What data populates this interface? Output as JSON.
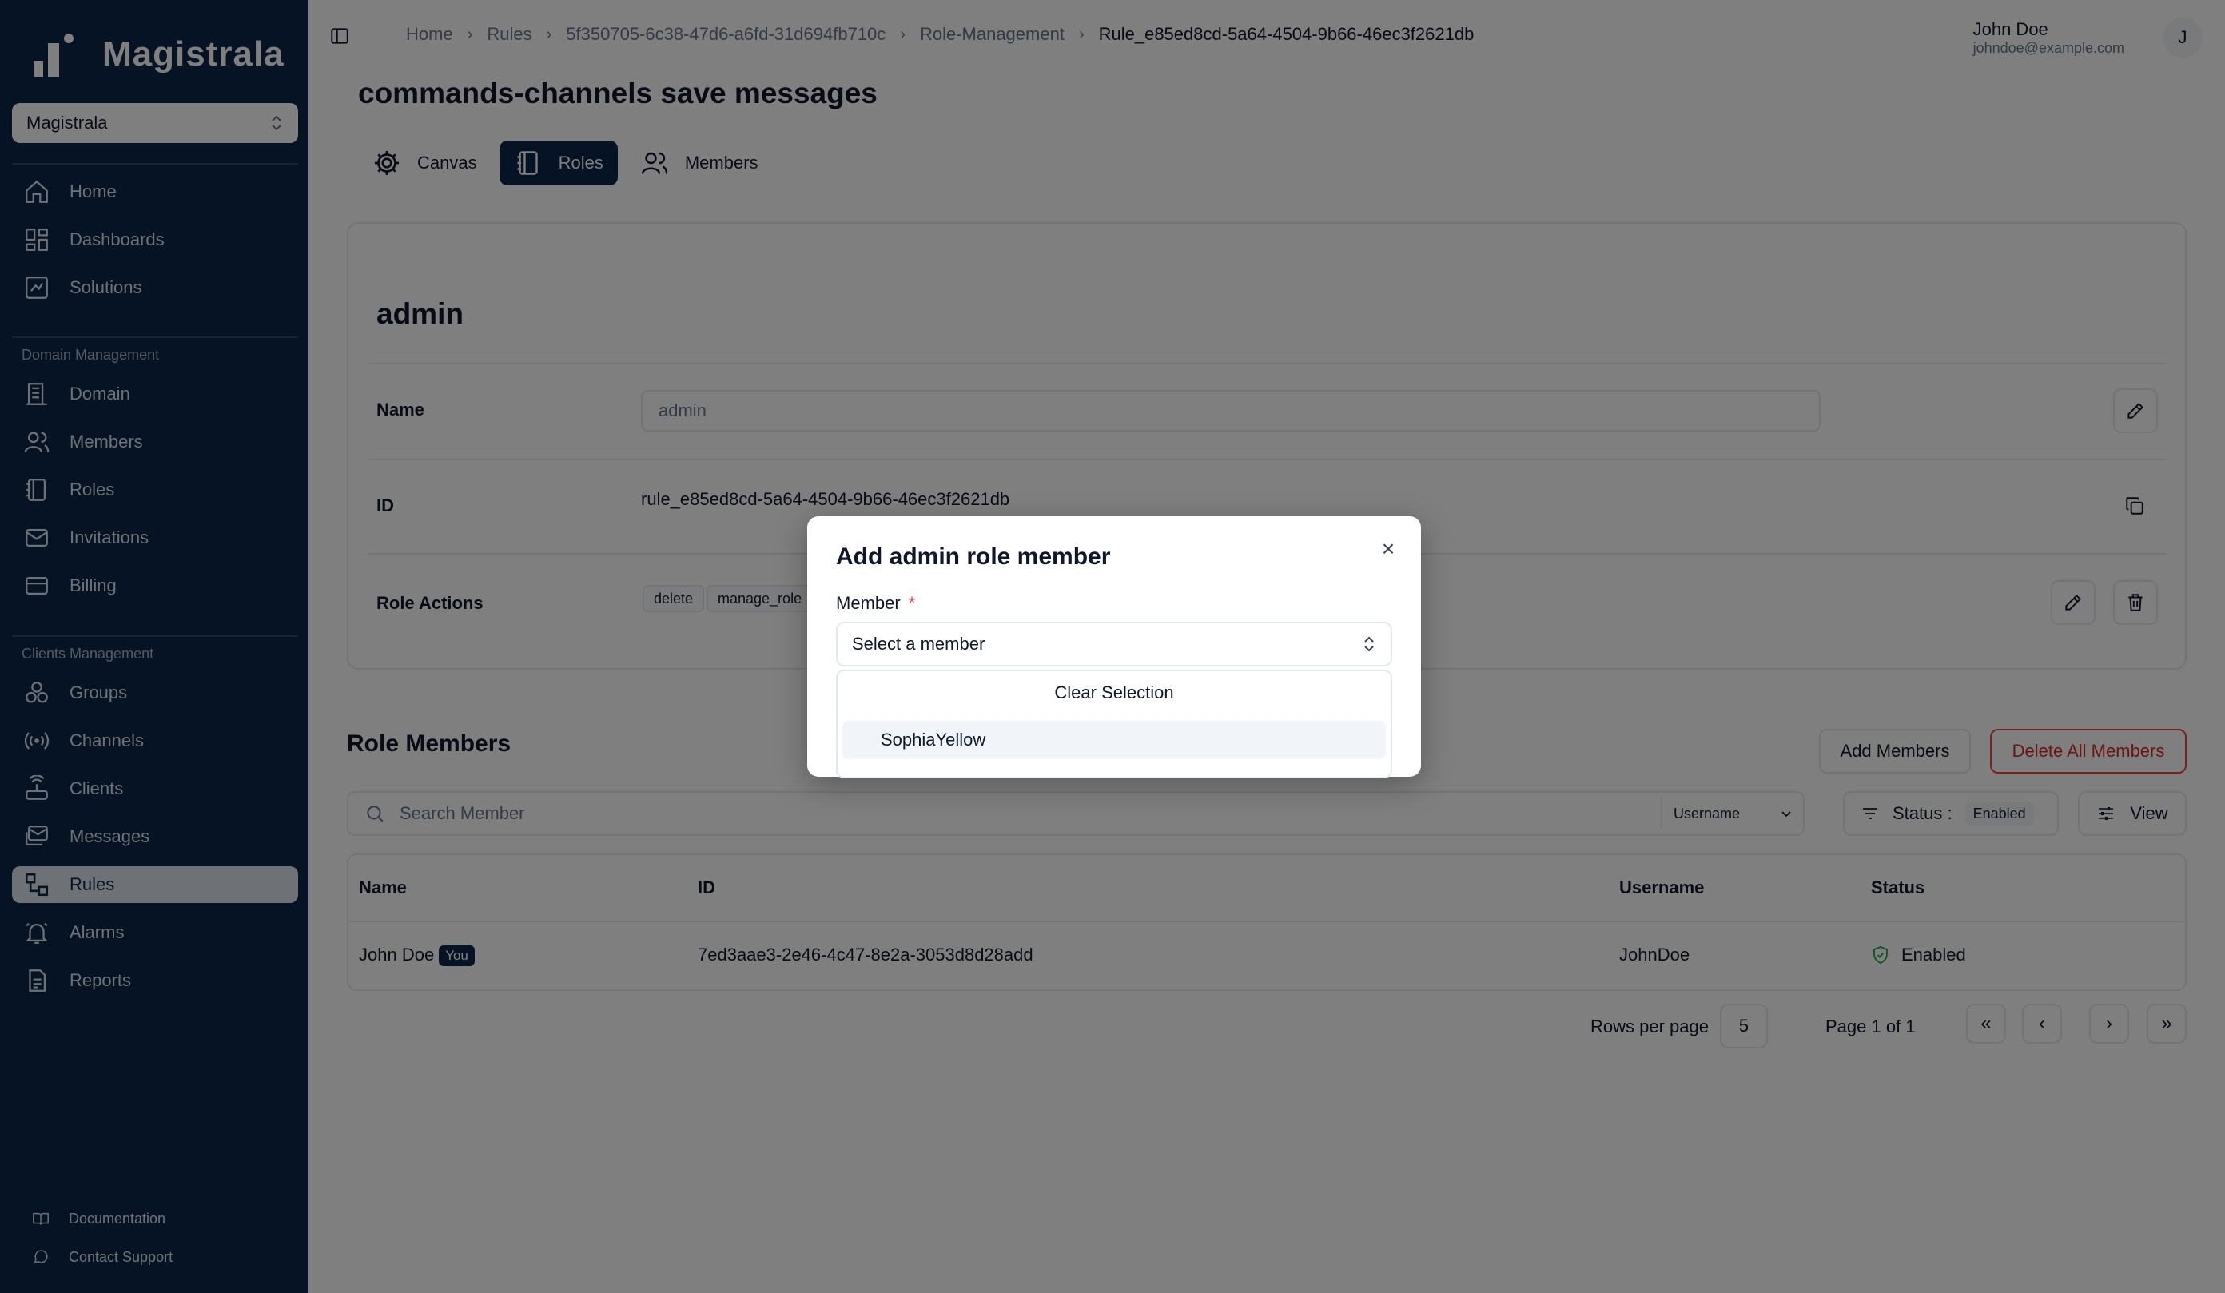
{
  "app": {
    "name": "Magistrala",
    "workspace": "Magistrala"
  },
  "sidebar": {
    "items": [
      {
        "label": "Home",
        "icon": "home-icon"
      },
      {
        "label": "Dashboards",
        "icon": "dashboard-icon"
      },
      {
        "label": "Solutions",
        "icon": "solutions-icon"
      }
    ],
    "domain_section": "Domain Management",
    "domain_items": [
      {
        "label": "Domain",
        "icon": "domain-icon"
      },
      {
        "label": "Members",
        "icon": "members-icon"
      },
      {
        "label": "Roles",
        "icon": "roles-icon"
      },
      {
        "label": "Invitations",
        "icon": "mail-icon"
      },
      {
        "label": "Billing",
        "icon": "card-icon"
      }
    ],
    "clients_section": "Clients Management",
    "clients_items": [
      {
        "label": "Groups",
        "icon": "groups-icon"
      },
      {
        "label": "Channels",
        "icon": "channels-icon"
      },
      {
        "label": "Clients",
        "icon": "clients-icon"
      },
      {
        "label": "Messages",
        "icon": "messages-icon"
      },
      {
        "label": "Rules",
        "icon": "rules-icon",
        "active": true
      },
      {
        "label": "Alarms",
        "icon": "bell-icon"
      },
      {
        "label": "Reports",
        "icon": "report-icon"
      }
    ],
    "footer": [
      {
        "label": "Documentation",
        "icon": "book-icon"
      },
      {
        "label": "Contact Support",
        "icon": "chat-icon"
      }
    ]
  },
  "breadcrumb": [
    "Home",
    "Rules",
    "5f350705-6c38-47d6-a6fd-31d694fb710c",
    "Role-Management",
    "Rule_e85ed8cd-5a64-4504-9b66-46ec3f2621db"
  ],
  "user": {
    "name": "John Doe",
    "email": "johndoe@example.com",
    "initial": "J"
  },
  "page": {
    "title": "commands-channels save messages",
    "tabs": [
      {
        "label": "Canvas"
      },
      {
        "label": "Roles",
        "active": true
      },
      {
        "label": "Members"
      }
    ]
  },
  "role": {
    "name": "admin",
    "name_label": "Name",
    "name_value": "admin",
    "id_label": "ID",
    "id_value": "rule_e85ed8cd-5a64-4504-9b66-46ec3f2621db",
    "actions_label": "Role Actions",
    "actions": [
      "delete",
      "manage_role"
    ]
  },
  "members": {
    "title": "Role Members",
    "add_button": "Add Members",
    "delete_all_button": "Delete All Members",
    "search_placeholder": "Search Member",
    "search_field": "Username",
    "status_label": "Status :",
    "status_value": "Enabled",
    "view_label": "View",
    "columns": [
      "Name",
      "ID",
      "Username",
      "Status"
    ],
    "rows": [
      {
        "name": "John Doe",
        "badge": "You",
        "id": "7ed3aae3-2e46-4c47-8e2a-3053d8d28add",
        "username": "JohnDoe",
        "status": "Enabled"
      }
    ],
    "rows_per_page_label": "Rows per page",
    "rows_per_page": "5",
    "page_info": "Page 1 of 1"
  },
  "dialog": {
    "title": "Add admin role member",
    "member_label": "Member",
    "required_mark": "*",
    "select_placeholder": "Select a member",
    "clear_selection": "Clear Selection",
    "options": [
      "SophiaYellow"
    ]
  },
  "colors": {
    "sidebar": "#0d2748",
    "accent": "#0d2748",
    "danger": "#dc2626",
    "success": "#16a34a"
  }
}
